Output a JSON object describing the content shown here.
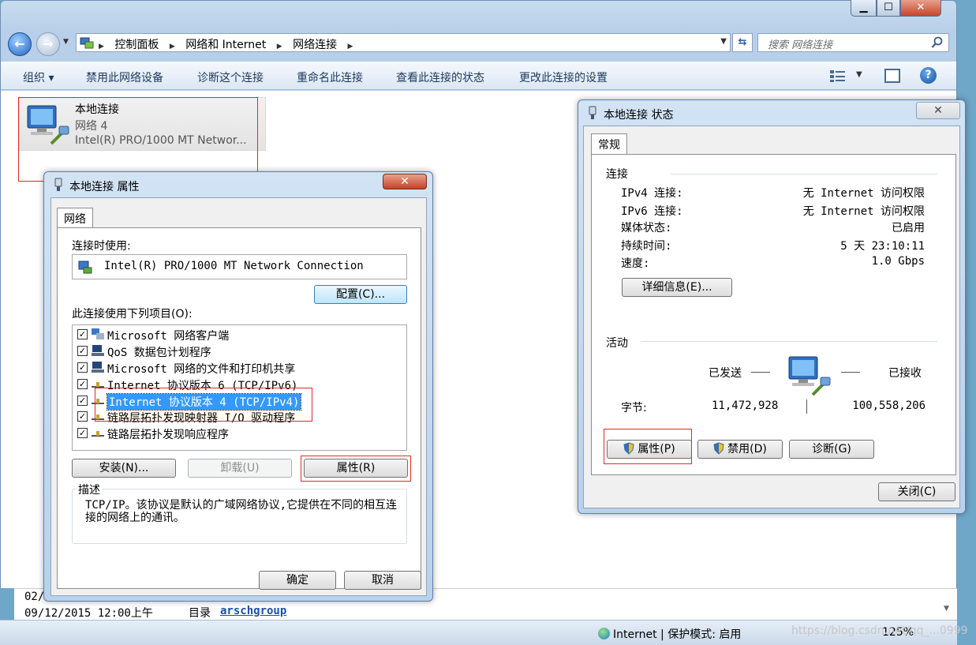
{
  "explorer": {
    "breadcrumbs": [
      "控制面板",
      "网络和 Internet",
      "网络连接"
    ],
    "search_placeholder": "搜索 网络连接",
    "toolbar": {
      "organize": "组织 ▾",
      "disable": "禁用此网络设备",
      "diagnose": "诊断这个连接",
      "rename": "重命名此连接",
      "view_status": "查看此连接的状态",
      "change_settings": "更改此连接的设置"
    },
    "connection": {
      "name": "本地连接",
      "network": "网络 4",
      "device": "Intel(R) PRO/1000 MT Networ..."
    },
    "details": {
      "row1_date": "02/",
      "row2_date": "09/12/2015 12:00上午",
      "row2_type": "目录",
      "row2_link": "arschgroup"
    },
    "status_bar": {
      "zone": "Internet | 保护模式: 启用",
      "zoom": "125%"
    },
    "watermark": "https://blog.csdn.net/qq_...0999"
  },
  "props_dialog": {
    "title": "本地连接 属性",
    "tab": "网络",
    "connect_using_label": "连接时使用:",
    "adapter": "Intel(R) PRO/1000 MT Network Connection",
    "configure_button": "配置(C)...",
    "items_label": "此连接使用下列项目(O):",
    "items": [
      {
        "label": "Microsoft 网络客户端",
        "checked": true,
        "icon": "network-client-icon"
      },
      {
        "label": "QoS 数据包计划程序",
        "checked": true,
        "icon": "qos-icon"
      },
      {
        "label": "Microsoft 网络的文件和打印机共享",
        "checked": true,
        "icon": "file-share-icon"
      },
      {
        "label": "Internet 协议版本 6 (TCP/IPv6)",
        "checked": true,
        "icon": "protocol-icon"
      },
      {
        "label": "Internet 协议版本 4 (TCP/IPv4)",
        "checked": true,
        "icon": "protocol-icon"
      },
      {
        "label": "链路层拓扑发现映射器 I/O 驱动程序",
        "checked": true,
        "icon": "protocol-icon"
      },
      {
        "label": "链路层拓扑发现响应程序",
        "checked": true,
        "icon": "protocol-icon"
      }
    ],
    "selected_index": 4,
    "install_button": "安装(N)...",
    "uninstall_button": "卸载(U)",
    "properties_button": "属性(R)",
    "description_legend": "描述",
    "description_text": "TCP/IP。该协议是默认的广域网络协议,它提供在不同的相互连接的网络上的通讯。",
    "ok_button": "确定",
    "cancel_button": "取消"
  },
  "status_dialog": {
    "title": "本地连接 状态",
    "tab": "常规",
    "connection_section": "连接",
    "rows": [
      {
        "label": "IPv4 连接:",
        "value": "无 Internet 访问权限"
      },
      {
        "label": "IPv6 连接:",
        "value": "无 Internet 访问权限"
      },
      {
        "label": "媒体状态:",
        "value": "已启用"
      },
      {
        "label": "持续时间:",
        "value": "5 天 23:10:11"
      },
      {
        "label": "速度:",
        "value": "1.0 Gbps"
      }
    ],
    "details_button": "详细信息(E)...",
    "activity_section": "活动",
    "sent_label": "已发送",
    "received_label": "已接收",
    "bytes_label": "字节:",
    "bytes_sent": "11,472,928",
    "bytes_received": "100,558,206",
    "properties_button": "属性(P)",
    "disable_button": "禁用(D)",
    "diagnose_button": "诊断(G)",
    "close_button": "关闭(C)"
  }
}
